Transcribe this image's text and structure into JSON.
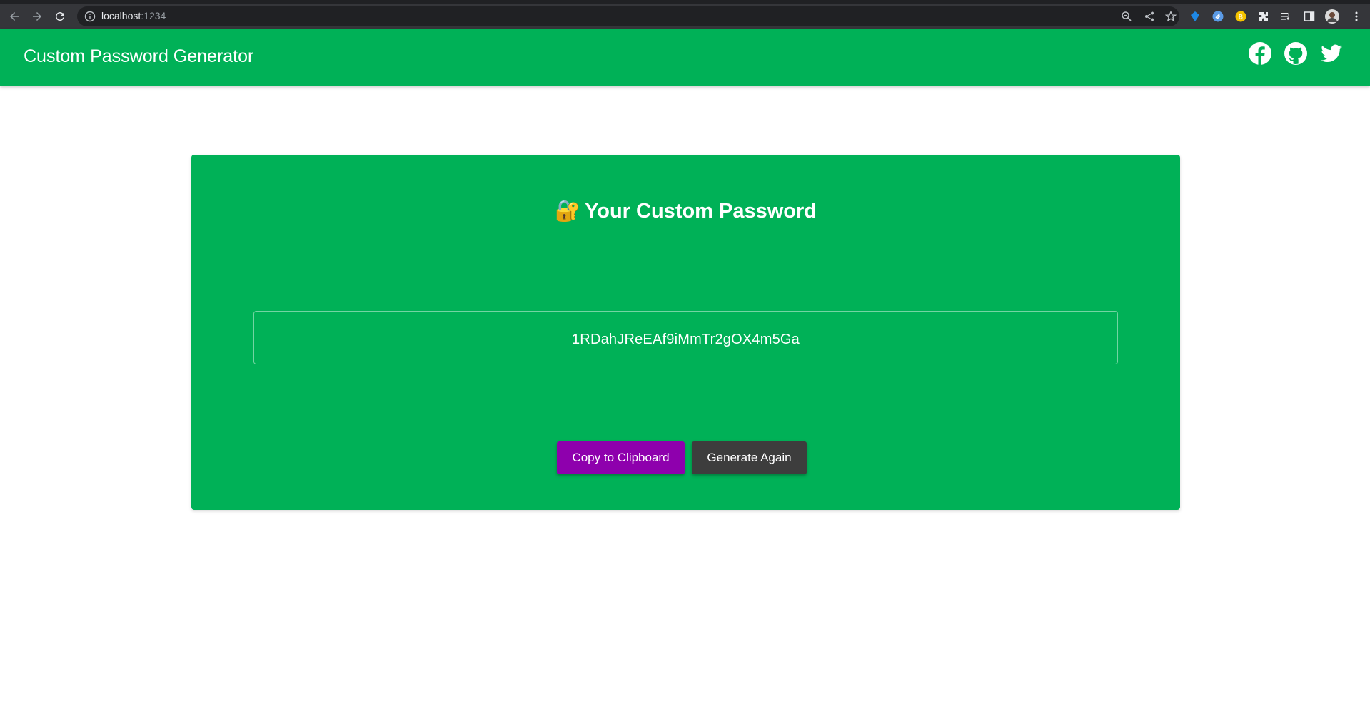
{
  "browser": {
    "url_host": "localhost",
    "url_port": ":1234",
    "icons": [
      "back-icon",
      "forward-icon",
      "reload-icon",
      "info-icon",
      "zoom-icon",
      "share-icon",
      "bookmark-star-icon",
      "extension-icon",
      "puzzle-icon",
      "reading-list-icon",
      "side-panel-icon",
      "profile-avatar",
      "kebab-menu-icon"
    ]
  },
  "header": {
    "title": "Custom Password Generator",
    "social": [
      "facebook-icon",
      "github-icon",
      "twitter-icon"
    ]
  },
  "card": {
    "icon": "🔐",
    "title": "Your Custom Password",
    "password": "1RDahJReEAf9iMmTr2gOX4m5Ga",
    "copy_label": "Copy to Clipboard",
    "generate_label": "Generate Again"
  },
  "colors": {
    "brand_green": "#00b157",
    "copy_button": "#8e00ad",
    "generate_button": "#3d3d3d",
    "chrome_bg": "#35363a"
  }
}
